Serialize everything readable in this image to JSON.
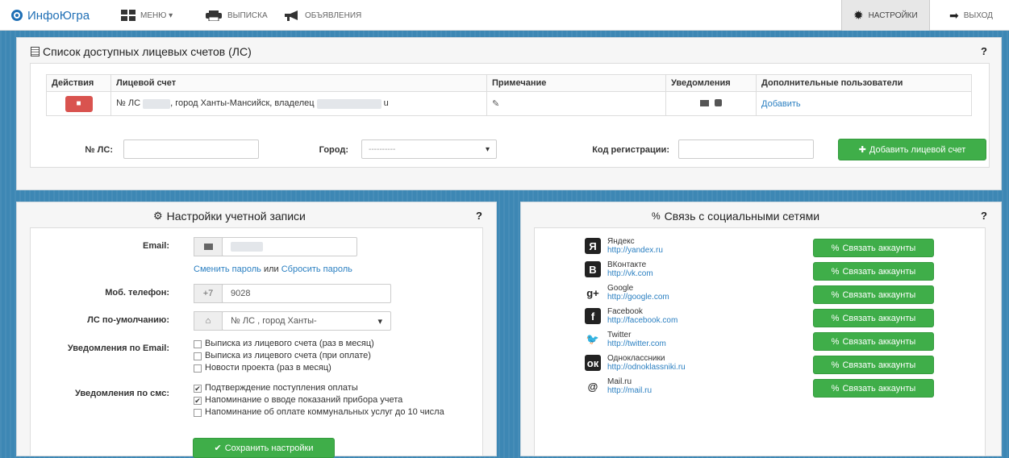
{
  "nav": {
    "brand": "ИнфоЮгра",
    "menu": "МЕНЮ ▾",
    "statement": "ВЫПИСКА",
    "ads": "ОБЪЯВЛЕНИЯ",
    "settings": "НАСТРОЙКИ",
    "logout": "ВЫХОД"
  },
  "accounts_panel": {
    "title": "Список доступных лицевых счетов (ЛС)",
    "help": "?",
    "columns": [
      "Действия",
      "Лицевой счет",
      "Примечание",
      "Уведомления",
      "Дополнительные пользователи"
    ],
    "row": {
      "account_prefix": "№ ЛС",
      "account_mid": ", город Ханты-Мансийск, владелец",
      "account_suffix": "u",
      "add_user": "Добавить"
    },
    "form": {
      "ls_label": "№ ЛС:",
      "city_label": "Город:",
      "city_value": "----------",
      "code_label": "Код регистрации:",
      "add_button": "Добавить лицевой счет"
    }
  },
  "account_settings": {
    "title": "Настройки учетной записи",
    "help": "?",
    "email_label": "Email:",
    "change_password": "Сменить пароль",
    "or": "или",
    "reset_password": "Сбросить пароль",
    "phone_label": "Моб. телефон:",
    "phone_code": "+7",
    "phone_value": "9028",
    "default_ls_label": "ЛС по-умолчанию:",
    "default_ls_value": "№ ЛС          , город Ханты-",
    "email_notif_label": "Уведомления по Email:",
    "email_notifs": [
      {
        "label": "Выписка из лицевого счета (раз в месяц)",
        "checked": false
      },
      {
        "label": "Выписка из лицевого счета (при оплате)",
        "checked": false
      },
      {
        "label": "Новости проекта (раз в месяц)",
        "checked": false
      }
    ],
    "sms_notif_label": "Уведомления по смс:",
    "sms_notifs": [
      {
        "label": "Подтверждение поступления оплаты",
        "checked": true
      },
      {
        "label": "Напоминание о вводе показаний прибора учета",
        "checked": true
      },
      {
        "label": "Напоминание об оплате коммунальных услуг до 10 числа",
        "checked": false
      }
    ],
    "save_button": "Сохранить настройки"
  },
  "social": {
    "title": "Связь с социальными сетями",
    "help": "?",
    "link_button": "Связать аккаунты",
    "networks": [
      {
        "name": "Яндекс",
        "url": "http://yandex.ru",
        "icon": "Я"
      },
      {
        "name": "ВКонтакте",
        "url": "http://vk.com",
        "icon": "B"
      },
      {
        "name": "Google",
        "url": "http://google.com",
        "icon": "g+"
      },
      {
        "name": "Facebook",
        "url": "http://facebook.com",
        "icon": "f"
      },
      {
        "name": "Twitter",
        "url": "http://twitter.com",
        "icon": "🐦"
      },
      {
        "name": "Одноклассники",
        "url": "http://odnoklassniki.ru",
        "icon": "ок"
      },
      {
        "name": "Mail.ru",
        "url": "http://mail.ru",
        "icon": "@"
      }
    ]
  }
}
